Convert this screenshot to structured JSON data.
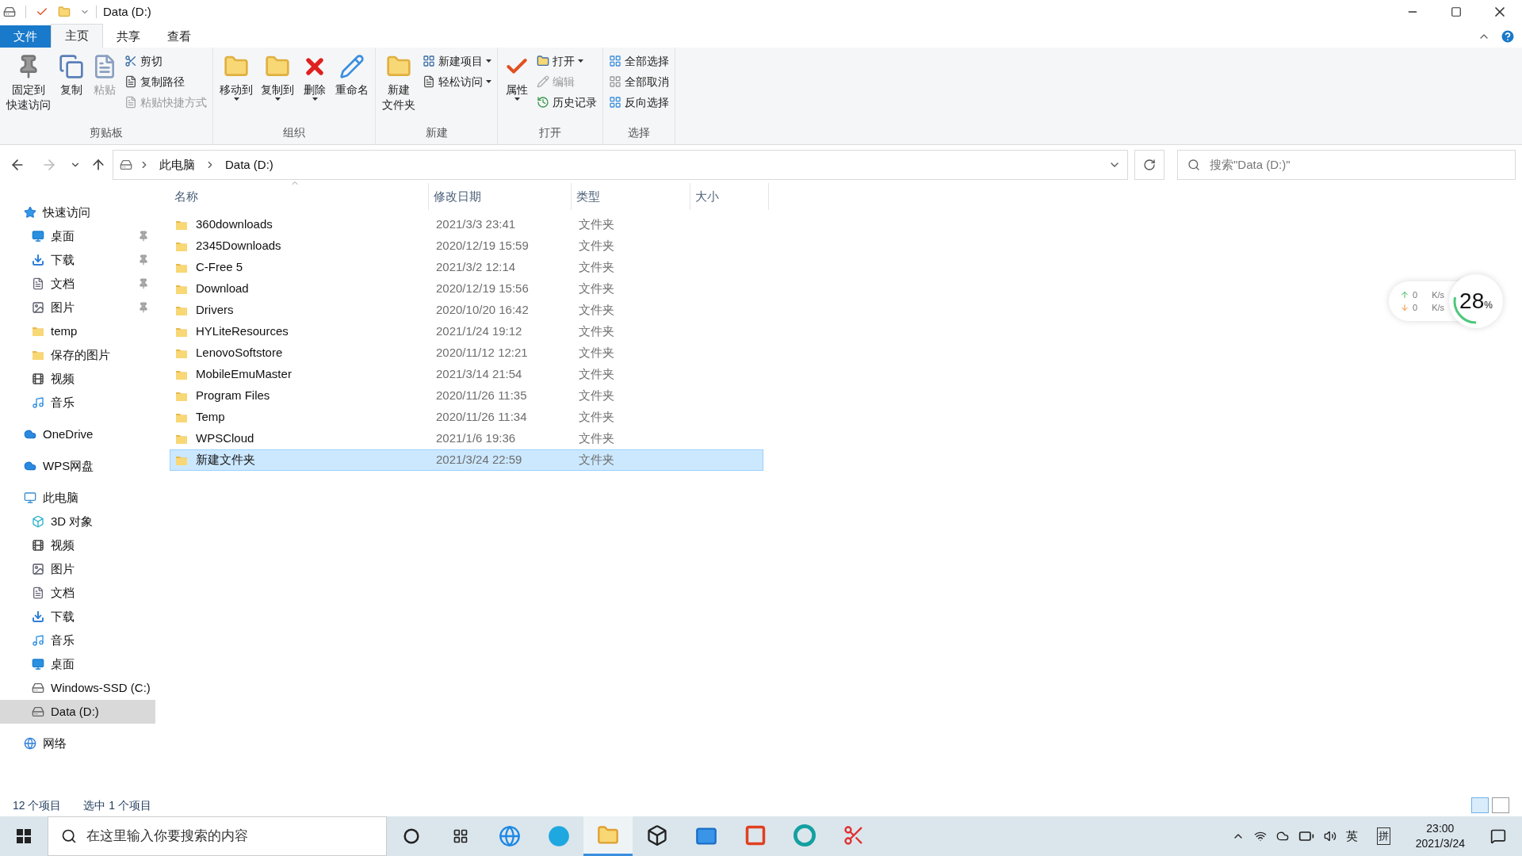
{
  "window": {
    "title": "Data (D:)"
  },
  "tabs": [
    {
      "label": "文件",
      "selected": false,
      "kind": "file"
    },
    {
      "label": "主页",
      "selected": true,
      "kind": "tab"
    },
    {
      "label": "共享",
      "selected": false,
      "kind": "tab"
    },
    {
      "label": "查看",
      "selected": false,
      "kind": "tab"
    }
  ],
  "ribbon": [
    {
      "label": "剪贴板",
      "items": [
        {
          "kind": "large",
          "lines": [
            "固定到",
            "快速访问"
          ],
          "disabled": false,
          "dropdown": false
        },
        {
          "kind": "large",
          "lines": [
            "复制"
          ],
          "disabled": false,
          "dropdown": false
        },
        {
          "kind": "large",
          "lines": [
            "粘贴"
          ],
          "disabled": true,
          "dropdown": false
        },
        {
          "kind": "small",
          "label": "剪切",
          "disabled": false,
          "dropdown": false
        },
        {
          "kind": "small",
          "label": "复制路径",
          "disabled": false,
          "dropdown": false
        },
        {
          "kind": "small",
          "label": "粘贴快捷方式",
          "disabled": true,
          "dropdown": false
        }
      ]
    },
    {
      "label": "组织",
      "items": [
        {
          "kind": "large",
          "lines": [
            "移动到"
          ],
          "disabled": false,
          "dropdown": true
        },
        {
          "kind": "large",
          "lines": [
            "复制到"
          ],
          "disabled": false,
          "dropdown": true
        },
        {
          "kind": "large",
          "lines": [
            "删除"
          ],
          "disabled": false,
          "dropdown": true
        },
        {
          "kind": "large",
          "lines": [
            "重命名"
          ],
          "disabled": false,
          "dropdown": false
        }
      ]
    },
    {
      "label": "新建",
      "items": [
        {
          "kind": "large",
          "lines": [
            "新建",
            "文件夹"
          ],
          "disabled": false,
          "dropdown": false
        },
        {
          "kind": "small",
          "label": "新建项目",
          "disabled": false,
          "dropdown": true
        },
        {
          "kind": "small",
          "label": "轻松访问",
          "disabled": false,
          "dropdown": true
        }
      ]
    },
    {
      "label": "打开",
      "items": [
        {
          "kind": "large",
          "lines": [
            "属性"
          ],
          "disabled": false,
          "dropdown": true
        },
        {
          "kind": "small",
          "label": "打开",
          "disabled": false,
          "dropdown": true
        },
        {
          "kind": "small",
          "label": "编辑",
          "disabled": true,
          "dropdown": false
        },
        {
          "kind": "small",
          "label": "历史记录",
          "disabled": false,
          "dropdown": false
        }
      ]
    },
    {
      "label": "选择",
      "items": [
        {
          "kind": "small",
          "label": "全部选择",
          "disabled": false,
          "dropdown": false
        },
        {
          "kind": "small",
          "label": "全部取消",
          "disabled": false,
          "dropdown": false
        },
        {
          "kind": "small",
          "label": "反向选择",
          "disabled": false,
          "dropdown": false
        }
      ]
    }
  ],
  "address": {
    "breadcrumb": [
      "此电脑",
      "Data (D:)"
    ]
  },
  "search": {
    "placeholder": "搜索\"Data (D:)\""
  },
  "sidebar": {
    "items": [
      {
        "label": "快速访问",
        "kind": "star",
        "selected": false,
        "children": [
          {
            "label": "桌面",
            "kind": "desktop",
            "pinned": true,
            "selected": false
          },
          {
            "label": "下载",
            "kind": "download",
            "pinned": true,
            "selected": false
          },
          {
            "label": "文档",
            "kind": "document",
            "pinned": true,
            "selected": false
          },
          {
            "label": "图片",
            "kind": "picture",
            "pinned": true,
            "selected": false
          },
          {
            "label": "temp",
            "kind": "folder",
            "pinned": false,
            "selected": false
          },
          {
            "label": "保存的图片",
            "kind": "folder",
            "pinned": false,
            "selected": false
          },
          {
            "label": "视频",
            "kind": "video",
            "pinned": false,
            "selected": false
          },
          {
            "label": "音乐",
            "kind": "music",
            "pinned": false,
            "selected": false
          }
        ]
      },
      {
        "label": "OneDrive",
        "kind": "cloud",
        "selected": false
      },
      {
        "label": "WPS网盘",
        "kind": "cloud",
        "selected": false
      },
      {
        "label": "此电脑",
        "kind": "computer",
        "selected": false,
        "children": [
          {
            "label": "3D 对象",
            "kind": "cube",
            "pinned": false,
            "selected": false
          },
          {
            "label": "视频",
            "kind": "video",
            "pinned": false,
            "selected": false
          },
          {
            "label": "图片",
            "kind": "picture",
            "pinned": false,
            "selected": false
          },
          {
            "label": "文档",
            "kind": "document",
            "pinned": false,
            "selected": false
          },
          {
            "label": "下载",
            "kind": "download",
            "pinned": false,
            "selected": false
          },
          {
            "label": "音乐",
            "kind": "music",
            "pinned": false,
            "selected": false
          },
          {
            "label": "桌面",
            "kind": "desktop",
            "pinned": false,
            "selected": false
          },
          {
            "label": "Windows-SSD (C:)",
            "kind": "drive",
            "pinned": false,
            "selected": false
          },
          {
            "label": "Data (D:)",
            "kind": "drive",
            "pinned": false,
            "selected": true
          }
        ]
      },
      {
        "label": "网络",
        "kind": "network",
        "selected": false
      }
    ]
  },
  "table": {
    "columns": [
      "名称",
      "修改日期",
      "类型",
      "大小"
    ],
    "rows": [
      {
        "name": "360downloads",
        "modified": "2021/3/3 23:41",
        "type": "文件夹",
        "selected": false
      },
      {
        "name": "2345Downloads",
        "modified": "2020/12/19 15:59",
        "type": "文件夹",
        "selected": false
      },
      {
        "name": "C-Free 5",
        "modified": "2021/3/2 12:14",
        "type": "文件夹",
        "selected": false
      },
      {
        "name": "Download",
        "modified": "2020/12/19 15:56",
        "type": "文件夹",
        "selected": false
      },
      {
        "name": "Drivers",
        "modified": "2020/10/20 16:42",
        "type": "文件夹",
        "selected": false
      },
      {
        "name": "HYLiteResources",
        "modified": "2021/1/24 19:12",
        "type": "文件夹",
        "selected": false
      },
      {
        "name": "LenovoSoftstore",
        "modified": "2020/11/12 12:21",
        "type": "文件夹",
        "selected": false
      },
      {
        "name": "MobileEmuMaster",
        "modified": "2021/3/14 21:54",
        "type": "文件夹",
        "selected": false
      },
      {
        "name": "Program Files",
        "modified": "2020/11/26 11:35",
        "type": "文件夹",
        "selected": false
      },
      {
        "name": "Temp",
        "modified": "2020/11/26 11:34",
        "type": "文件夹",
        "selected": false
      },
      {
        "name": "WPSCloud",
        "modified": "2021/1/6 19:36",
        "type": "文件夹",
        "selected": false
      },
      {
        "name": "新建文件夹",
        "modified": "2021/3/24 22:59",
        "type": "文件夹",
        "selected": true
      }
    ]
  },
  "status_bar": {
    "item_count": "12 个项目",
    "selection": "选中 1 个项目"
  },
  "net_widget": {
    "upload": "0",
    "upload_unit": "K/s",
    "download": "0",
    "download_unit": "K/s",
    "percent": "28",
    "percent_sign": "%",
    "level": 0.28
  },
  "taskbar": {
    "search_placeholder": "在这里输入你要搜索的内容",
    "ime_lang": "英",
    "ime_mode": "拼",
    "time": "23:00",
    "date": "2021/3/24"
  }
}
